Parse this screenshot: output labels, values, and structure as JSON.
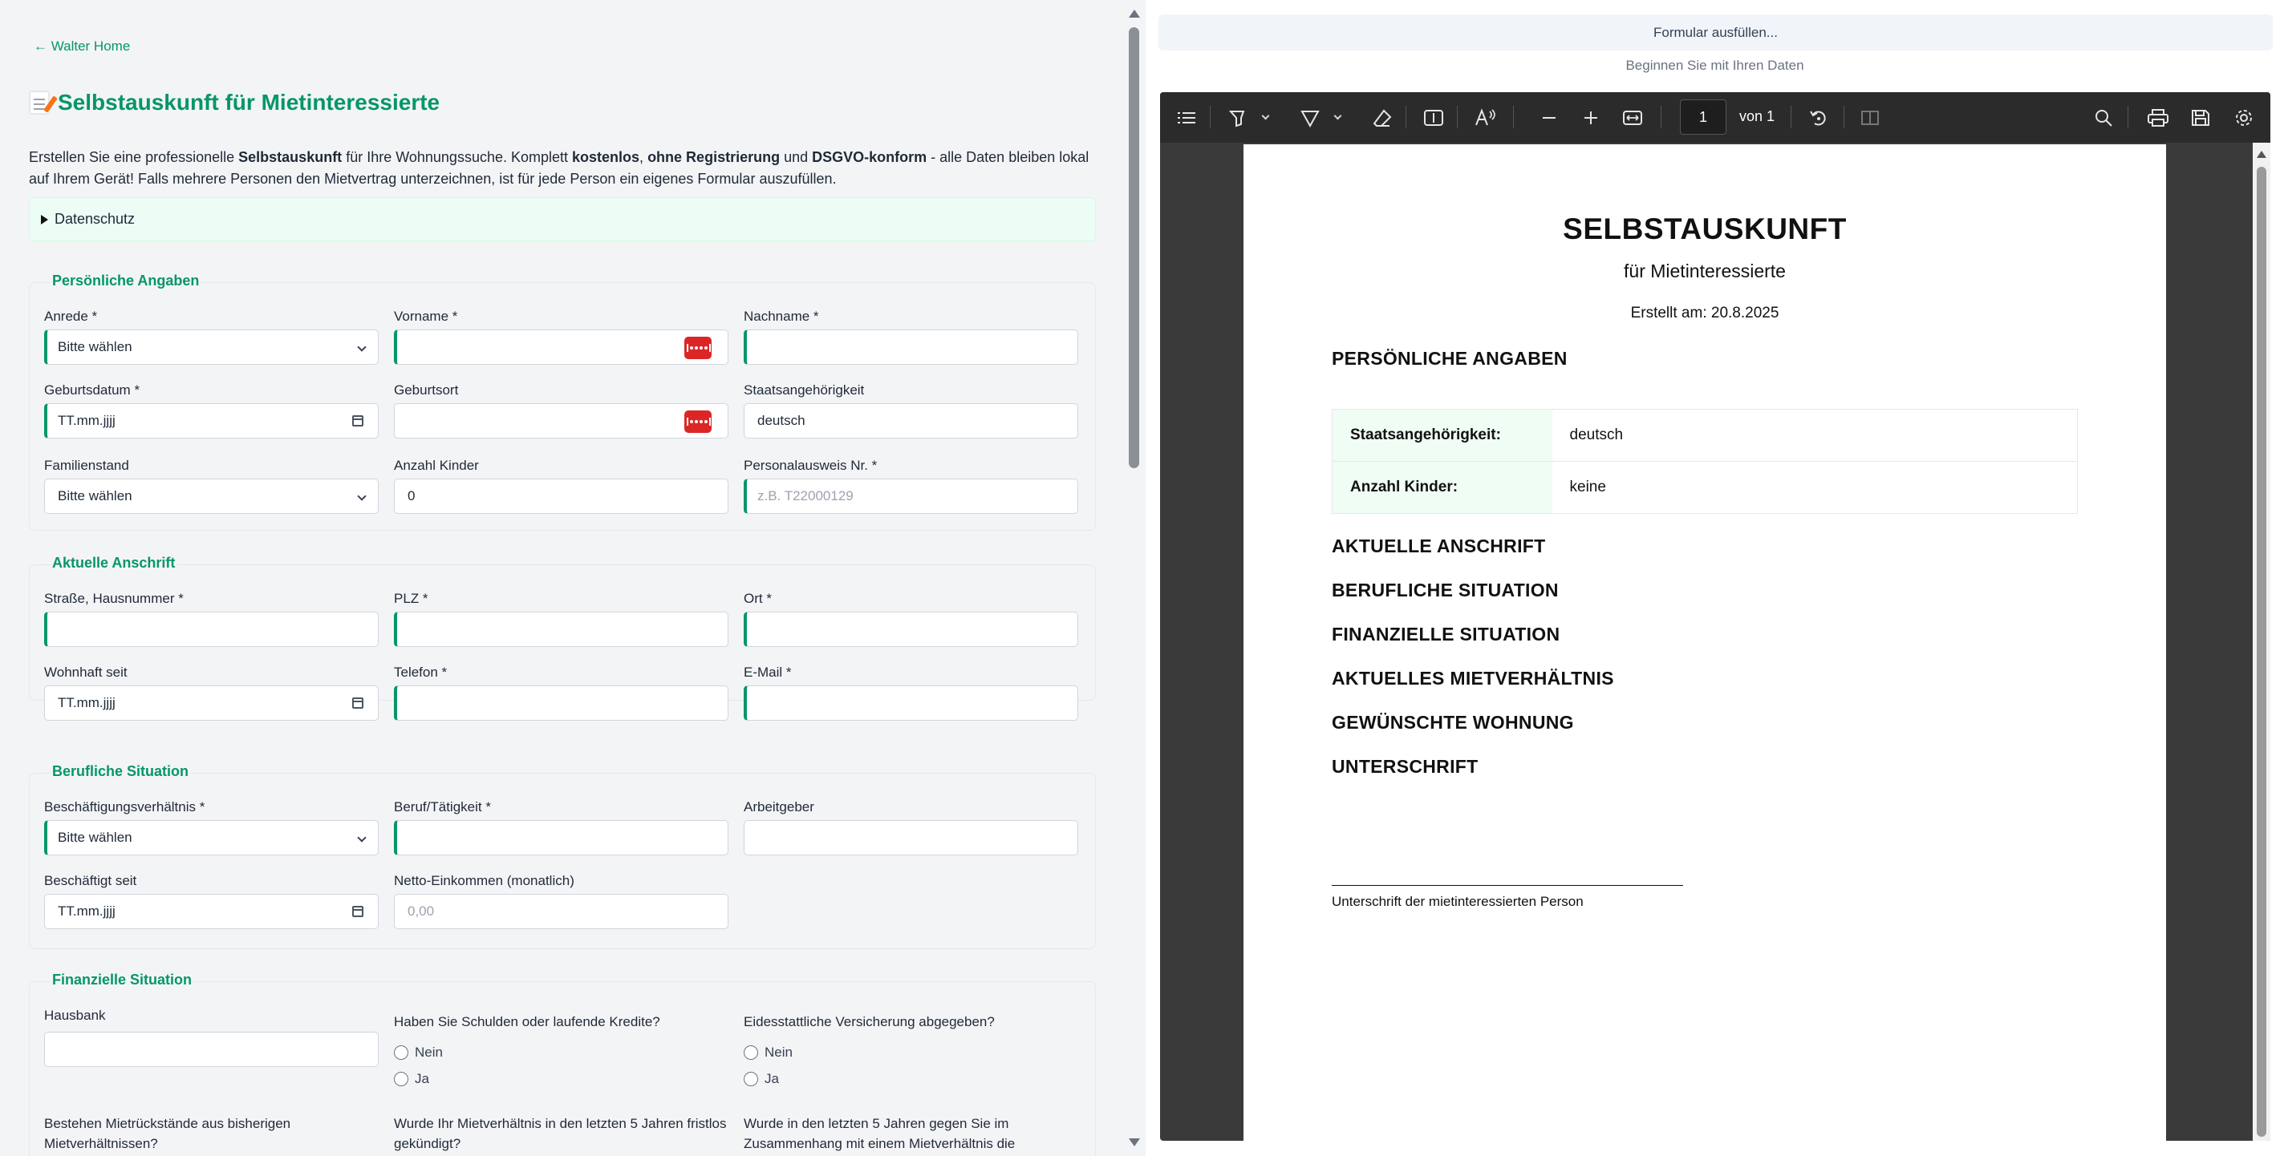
{
  "left": {
    "back_link": "← Walter Home",
    "title": "Selbstauskunft für Mietinteressierte",
    "intro": {
      "p1": "Erstellen Sie eine professionelle ",
      "b1": "Selbstauskunft",
      "p2": " für Ihre Wohnungssuche. Komplett ",
      "b2": "kostenlos",
      "p3": ", ",
      "b3": "ohne Registrierung",
      "p4": " und ",
      "b4": "DSGVO-konform",
      "p5": " - alle Daten bleiben lokal auf Ihrem Gerät! Falls mehrere Personen den Mietvertrag unterzeichnen, ist für jede Person ein eigenes Formular auszufüllen."
    },
    "privacy_summary": "Datenschutz",
    "personal": {
      "legend": "Persönliche Angaben",
      "anrede": {
        "label": "Anrede *",
        "value": "Bitte wählen"
      },
      "vorname": {
        "label": "Vorname *",
        "value": ""
      },
      "nachname": {
        "label": "Nachname *",
        "value": ""
      },
      "geburtsdatum": {
        "label": "Geburtsdatum *",
        "value": "TT.mm.jjjj"
      },
      "geburtsort": {
        "label": "Geburtsort",
        "value": ""
      },
      "staatsangehoerigkeit": {
        "label": "Staatsangehörigkeit",
        "value": "deutsch"
      },
      "familienstand": {
        "label": "Familienstand",
        "value": "Bitte wählen"
      },
      "kinder": {
        "label": "Anzahl Kinder",
        "value": "0"
      },
      "ausweis": {
        "label": "Personalausweis Nr. *",
        "placeholder": "z.B. T22000129"
      }
    },
    "address": {
      "legend": "Aktuelle Anschrift",
      "strasse": {
        "label": "Straße, Hausnummer *"
      },
      "plz": {
        "label": "PLZ *"
      },
      "ort": {
        "label": "Ort *"
      },
      "wohnhaft": {
        "label": "Wohnhaft seit",
        "value": "TT.mm.jjjj"
      },
      "telefon": {
        "label": "Telefon *"
      },
      "email": {
        "label": "E-Mail *"
      }
    },
    "job": {
      "legend": "Berufliche Situation",
      "verhaeltnis": {
        "label": "Beschäftigungsverhältnis *",
        "value": "Bitte wählen"
      },
      "beruf": {
        "label": "Beruf/Tätigkeit *"
      },
      "arbeitgeber": {
        "label": "Arbeitgeber"
      },
      "seit": {
        "label": "Beschäftigt seit",
        "value": "TT.mm.jjjj"
      },
      "netto": {
        "label": "Netto-Einkommen (monatlich)",
        "placeholder": "0,00"
      }
    },
    "finance": {
      "legend": "Finanzielle Situation",
      "hausbank": {
        "label": "Hausbank"
      },
      "schulden": {
        "label": "Haben Sie Schulden oder laufende Kredite?",
        "opt_no": "Nein",
        "opt_yes": "Ja"
      },
      "eid": {
        "label": "Eidesstattliche Versicherung abgegeben?",
        "opt_no": "Nein",
        "opt_yes": "Ja"
      },
      "q_mietrueck": "Bestehen Mietrückstände aus bisherigen Mietverhältnissen?",
      "q_kuendigung": "Wurde Ihr Mietverhältnis in den letzten 5 Jahren fristlos gekündigt?",
      "q_verfahren": "Wurde in den letzten 5 Jahren gegen Sie im Zusammenhang mit einem Mietverhältnis die"
    }
  },
  "right": {
    "fill_button": "Formular ausfüllen...",
    "status": "Beginnen Sie mit Ihren Daten",
    "viewer": {
      "page_number": "1",
      "page_of": "von 1"
    },
    "pdf": {
      "title": "SELBSTAUSKUNFT",
      "subtitle": "für Mietinteressierte",
      "created": "Erstellt am: 20.8.2025",
      "h_personal": "PERSÖNLICHE ANGABEN",
      "rows": [
        {
          "key": "Staatsangehörigkeit:",
          "value": "deutsch"
        },
        {
          "key": "Anzahl Kinder:",
          "value": "keine"
        }
      ],
      "h_address": "AKTUELLE ANSCHRIFT",
      "h_job": "BERUFLICHE SITUATION",
      "h_finance": "FINANZIELLE SITUATION",
      "h_rent": "AKTUELLES MIETVERHÄLTNIS",
      "h_wish": "GEWÜNSCHTE WOHNUNG",
      "h_sign": "UNTERSCHRIFT",
      "sign_label": "Unterschrift der mietinteressierten Person"
    }
  },
  "colors": {
    "accent": "#059669",
    "pw_badge": "#dc2626",
    "viewer_bg": "#3a3a3a"
  }
}
